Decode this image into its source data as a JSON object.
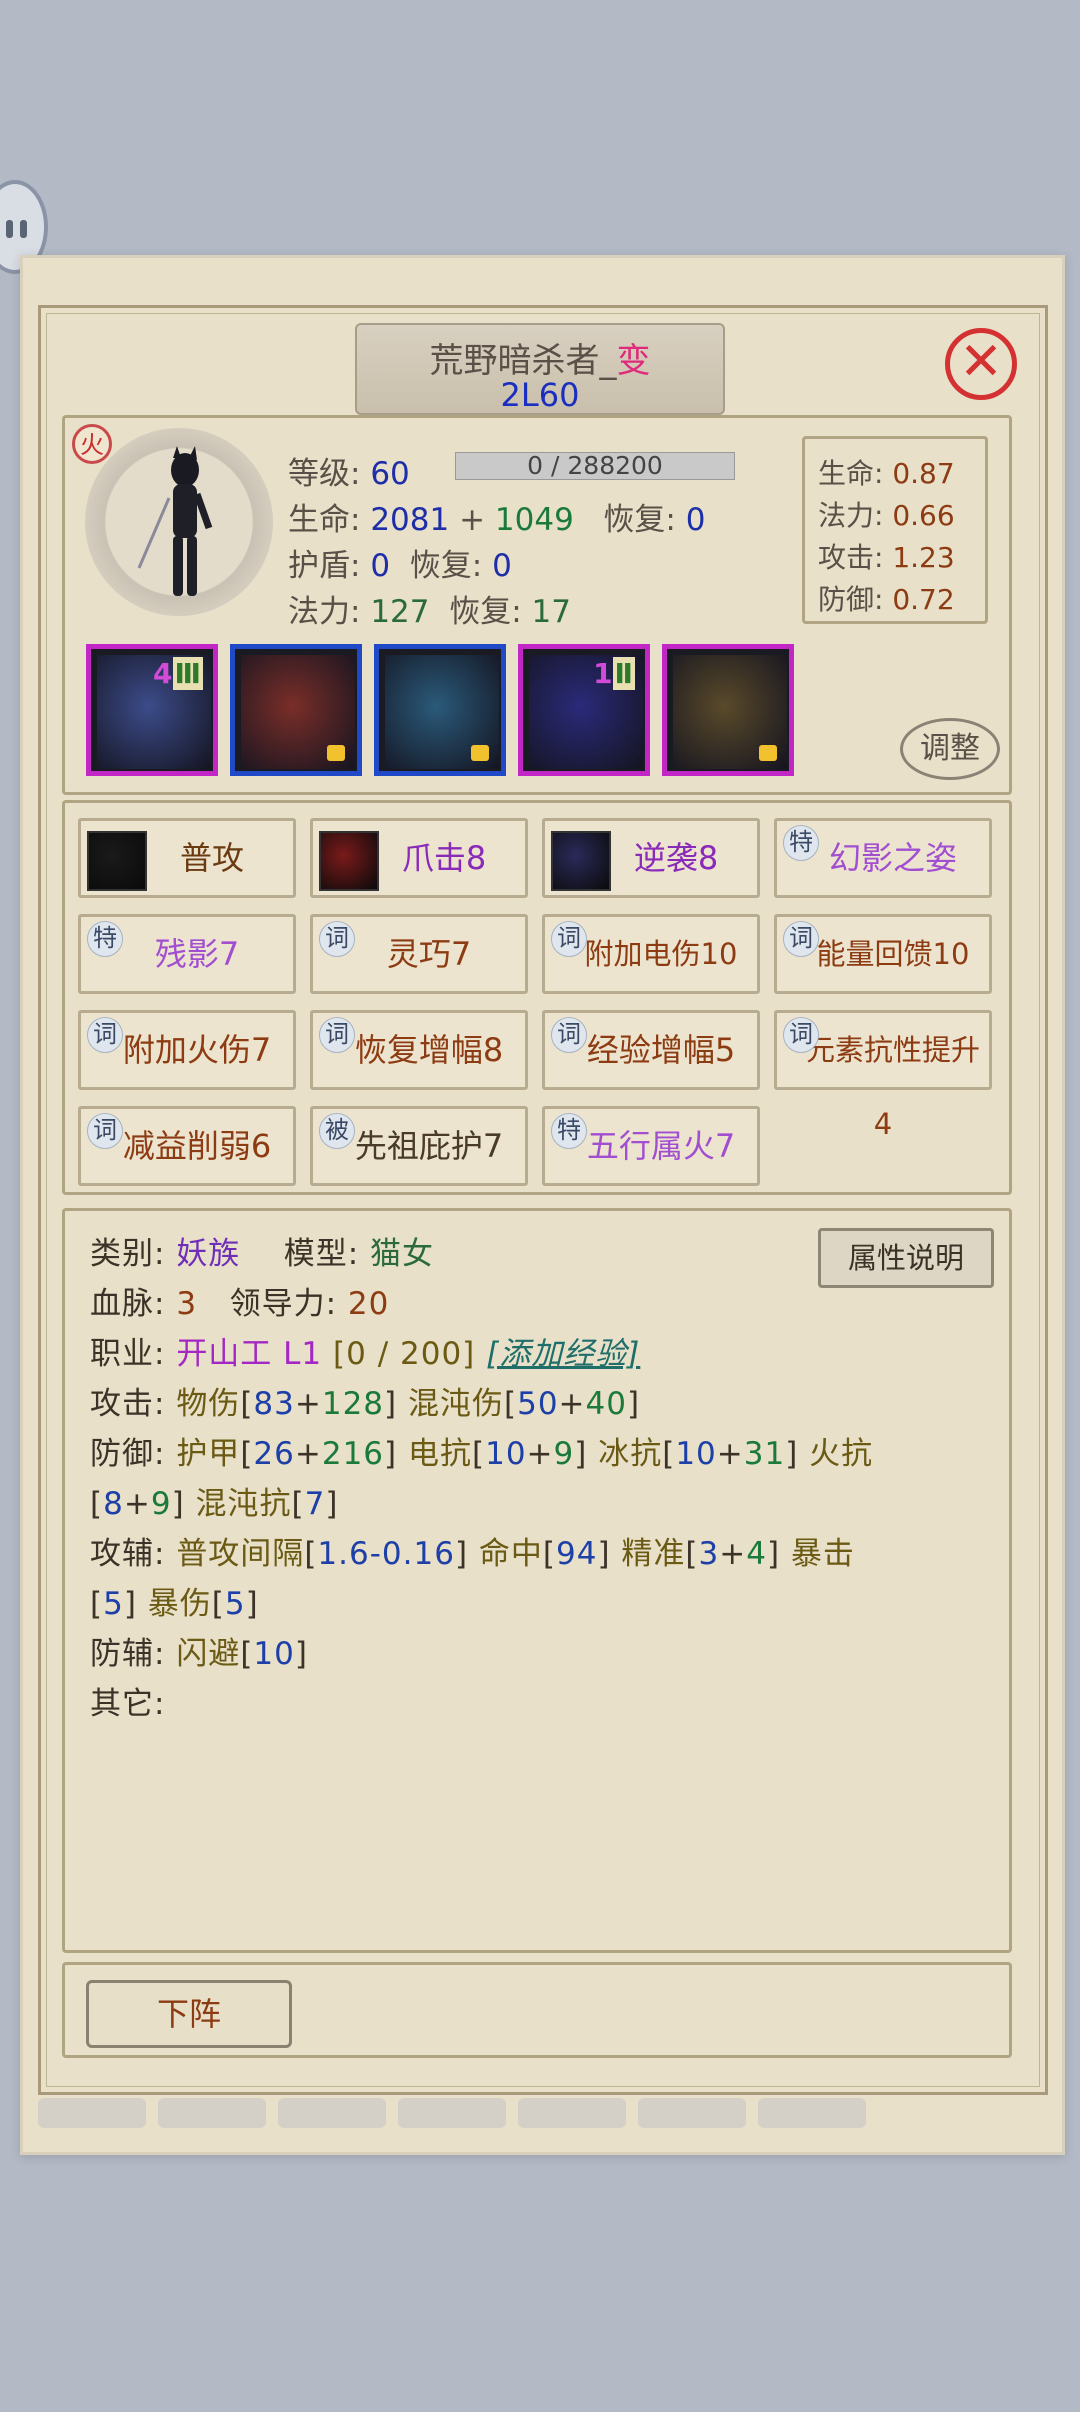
{
  "title": {
    "name": "荒野暗杀者_",
    "suffix": "变",
    "level_code": "2L60"
  },
  "element_badge": "火",
  "stats": {
    "level_label": "等级:",
    "level": "60",
    "exp": "0 / 288200",
    "hp_label": "生命:",
    "hp_base": "2081",
    "plus": "+",
    "hp_bonus": "1049",
    "regen_label": "恢复:",
    "hp_regen": "0",
    "shield_label": "护盾:",
    "shield": "0",
    "shield_regen": "0",
    "mana_label": "法力:",
    "mana": "127",
    "mana_regen": "17"
  },
  "ratios": [
    {
      "label": "生命:",
      "value": "0.87"
    },
    {
      "label": "法力:",
      "value": "0.66"
    },
    {
      "label": "攻击:",
      "value": "1.23"
    },
    {
      "label": "防御:",
      "value": "0.72"
    }
  ],
  "equipment": [
    {
      "name": "sword-shield",
      "badge_num": "4",
      "badge_roman": "Ⅲ",
      "border": "#c226c7",
      "locked": false,
      "color": "#3c4c8a"
    },
    {
      "name": "armor-robe",
      "badge_num": "",
      "badge_roman": "",
      "border": "#1f49c7",
      "locked": true,
      "color": "#7a2e28"
    },
    {
      "name": "boots",
      "badge_num": "",
      "badge_roman": "",
      "border": "#1f49c7",
      "locked": true,
      "color": "#2a5a7a"
    },
    {
      "name": "moon-charm",
      "badge_num": "1",
      "badge_roman": "Ⅱ",
      "border": "#c226c7",
      "locked": false,
      "color": "#2a2a7a"
    },
    {
      "name": "bone-helmet",
      "badge_num": "",
      "badge_roman": "",
      "border": "#c226c7",
      "locked": true,
      "color": "#5a4a2a"
    }
  ],
  "adjust_label": "调整",
  "skills": [
    {
      "tag": "",
      "label": "普攻",
      "color": "#6a3a10",
      "icon": "#1a1a1a"
    },
    {
      "tag": "",
      "label": "爪击8",
      "color": "#8a2ab8",
      "icon": "#7a1a1a"
    },
    {
      "tag": "",
      "label": "逆袭8",
      "color": "#8a2ab8",
      "icon": "#2a2a5a"
    },
    {
      "tag": "特",
      "label": "幻影之姿",
      "color": "#a14ed0",
      "icon": ""
    },
    {
      "tag": "特",
      "label": "残影7",
      "color": "#a14ed0",
      "icon": ""
    },
    {
      "tag": "词",
      "label": "灵巧7",
      "color": "#8c3b12",
      "icon": ""
    },
    {
      "tag": "词",
      "label": "附加电伤10",
      "color": "#8c3b12",
      "icon": ""
    },
    {
      "tag": "词",
      "label": "能量回馈10",
      "color": "#8c3b12",
      "icon": ""
    },
    {
      "tag": "词",
      "label": "附加火伤7",
      "color": "#8c3b12",
      "icon": ""
    },
    {
      "tag": "词",
      "label": "恢复增幅8",
      "color": "#8c3b12",
      "icon": ""
    },
    {
      "tag": "词",
      "label": "经验增幅5",
      "color": "#8c3b12",
      "icon": ""
    },
    {
      "tag": "词",
      "label": "元素抗性提升4",
      "color": "#8c3b12",
      "icon": ""
    },
    {
      "tag": "词",
      "label": "减益削弱6",
      "color": "#8c3b12",
      "icon": ""
    },
    {
      "tag": "被",
      "label": "先祖庇护7",
      "color": "#4a3a2a",
      "icon": ""
    },
    {
      "tag": "特",
      "label": "五行属火7",
      "color": "#a14ed0",
      "icon": ""
    }
  ],
  "info": {
    "attr_button": "属性说明",
    "category_label": "类别:",
    "category": "妖族",
    "model_label": "模型:",
    "model": "猫女",
    "bloodline_label": "血脉:",
    "bloodline": "3",
    "leadership_label": "领导力:",
    "leadership": "20",
    "job_label": "职业:",
    "job": "开山工 L1",
    "job_exp": "[0 / 200]",
    "add_exp": "[添加经验]",
    "attack_label": "攻击:",
    "physical": "物伤",
    "physical_a": "83",
    "physical_b": "128",
    "chaos": "混沌伤",
    "chaos_a": "50",
    "chaos_b": "40",
    "defense_label": "防御:",
    "armor": "护甲",
    "armor_a": "26",
    "armor_b": "216",
    "elec": "电抗",
    "elec_a": "10",
    "elec_b": "9",
    "ice": "冰抗",
    "ice_a": "10",
    "ice_b": "31",
    "fire": "火抗",
    "fire_a": "8",
    "fire_b": "9",
    "chaos_res": "混沌抗",
    "chaos_res_v": "7",
    "atk_aux_label": "攻辅:",
    "interval": "普攻间隔",
    "interval_v": "1.6-0.16",
    "hit": "命中",
    "hit_v": "94",
    "precise": "精准",
    "precise_a": "3",
    "precise_b": "4",
    "crit": "暴击",
    "crit_v": "5",
    "crit_dmg": "暴伤",
    "crit_dmg_v": "5",
    "def_aux_label": "防辅:",
    "dodge": "闪避",
    "dodge_v": "10",
    "other_label": "其它:"
  },
  "bottom_button": "下阵"
}
